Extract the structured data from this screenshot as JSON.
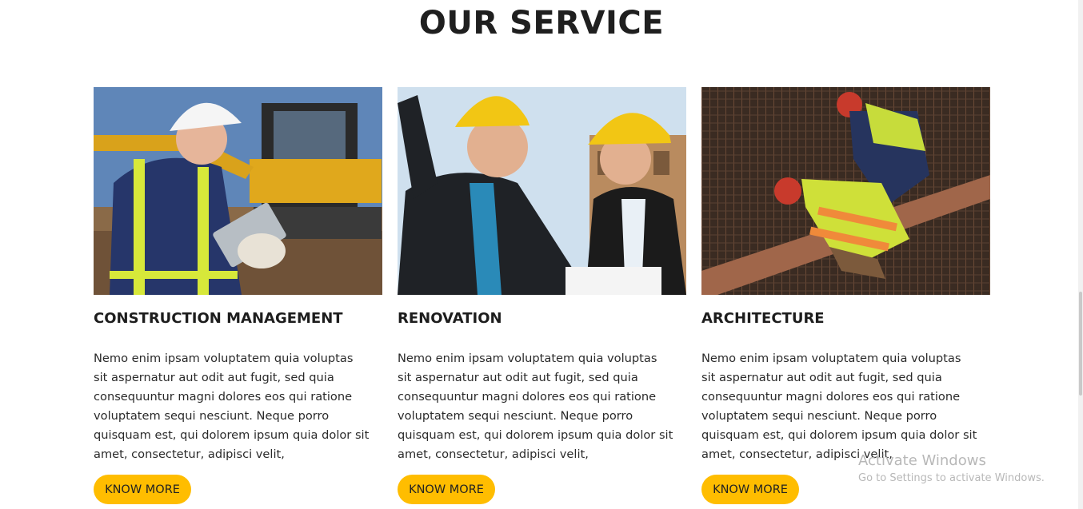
{
  "section": {
    "title": "OUR SERVICE"
  },
  "cards": [
    {
      "title": "CONSTRUCTION MANAGEMENT",
      "text": "Nemo enim ipsam voluptatem quia voluptas sit aspernatur aut odit aut fugit, sed quia consequuntur magni dolores eos qui ratione voluptatem sequi nesciunt. Neque porro quisquam est, qui dolorem ipsum quia dolor sit amet, consectetur, adipisci velit,",
      "button": "KNOW MORE",
      "image": "engineer-with-tablet-at-excavator-photo"
    },
    {
      "title": "RENOVATION",
      "text": "Nemo enim ipsam voluptatem quia voluptas sit aspernatur aut odit aut fugit, sed quia consequuntur magni dolores eos qui ratione voluptatem sequi nesciunt. Neque porro quisquam est, qui dolorem ipsum quia dolor sit amet, consectetur, adipisci velit,",
      "button": "KNOW MORE",
      "image": "two-engineers-in-hard-hats-photo"
    },
    {
      "title": "ARCHITECTURE",
      "text": "Nemo enim ipsam voluptatem quia voluptas sit aspernatur aut odit aut fugit, sed quia consequuntur magni dolores eos qui ratione voluptatem sequi nesciunt. Neque porro quisquam est, qui dolorem ipsum quia dolor sit amet, consectetur, adipisci velit,",
      "button": "KNOW MORE",
      "image": "workers-tying-rebar-photo"
    }
  ],
  "watermark": {
    "title": "Activate Windows",
    "subtitle": "Go to Settings to activate Windows."
  },
  "colors": {
    "accent": "#ffbd00",
    "text": "#222222"
  }
}
